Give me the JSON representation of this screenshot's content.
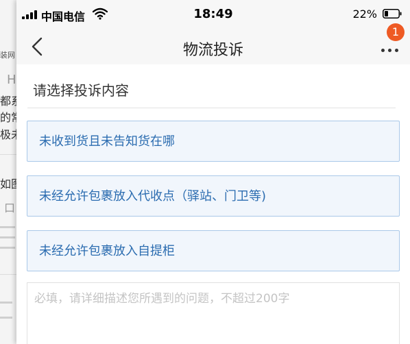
{
  "background_page": {
    "fragments": [
      "装网",
      "H",
      "都系",
      "的常",
      "极未",
      "如图",
      "口"
    ]
  },
  "status_bar": {
    "carrier": "中国电信",
    "time": "18:49",
    "battery": "22%"
  },
  "nav": {
    "title": "物流投诉",
    "badge_count": "1"
  },
  "complaint": {
    "section_title": "请选择投诉内容",
    "options": [
      "未收到货且未告知货在哪",
      "未经允许包裹放入代收点（驿站、门卫等)",
      "未经允许包裹放入自提柜"
    ],
    "description_placeholder": "必填，请详细描述您所遇到的问题，不超过200字"
  },
  "colors": {
    "accent": "#2b6cb0",
    "option_bg": "#f1f6fc",
    "option_border": "#a9c8e8",
    "badge": "#ee5a24"
  },
  "icons": [
    "signal-icon",
    "wifi-icon",
    "battery-icon",
    "back-arrow-icon",
    "more-dots-icon"
  ]
}
